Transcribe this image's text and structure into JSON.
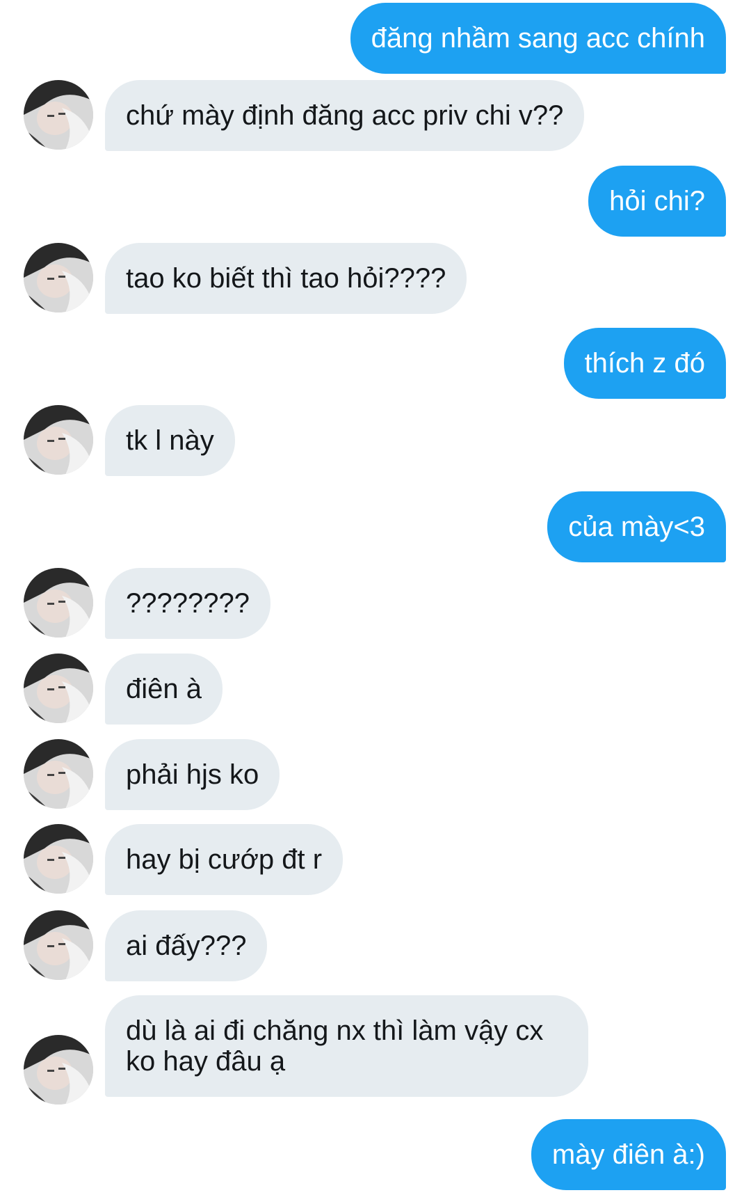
{
  "conversation": {
    "messages": [
      {
        "side": "out",
        "text": "đăng nhầm sang acc chính"
      },
      {
        "side": "in",
        "text": "chứ mày định đăng acc priv chi v??"
      },
      {
        "side": "out",
        "text": "hỏi chi?"
      },
      {
        "side": "in",
        "text": "tao ko biết thì tao hỏi????"
      },
      {
        "side": "out",
        "text": "thích z đó"
      },
      {
        "side": "in",
        "text": "tk l này"
      },
      {
        "side": "out",
        "text": "của mày<3"
      },
      {
        "side": "in",
        "text": "????????"
      },
      {
        "side": "in",
        "text": "điên à"
      },
      {
        "side": "in",
        "text": "phải hjs ko"
      },
      {
        "side": "in",
        "text": "hay bị cướp đt r"
      },
      {
        "side": "in",
        "text": "ai đấy???"
      },
      {
        "side": "in",
        "text": "dù là ai đi chăng nx thì làm vậy cx ko hay đâu ạ"
      },
      {
        "side": "out",
        "text": "mày điên à:)"
      }
    ]
  },
  "colors": {
    "outgoing_bubble": "#1da1f2",
    "incoming_bubble": "#e6ecf0",
    "background": "#ffffff"
  }
}
